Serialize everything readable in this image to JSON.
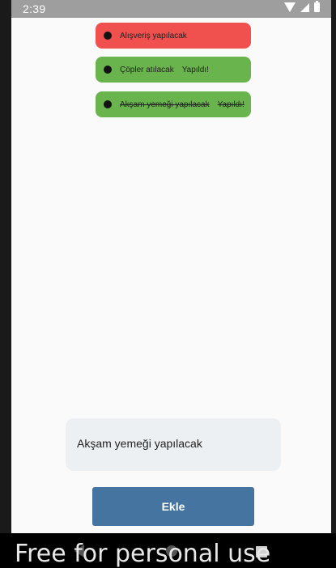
{
  "status_bar": {
    "time": "2:39"
  },
  "todos": [
    {
      "text": "Alışveriş yapılacak",
      "status": ""
    },
    {
      "text": "Çöpler atılacak",
      "status": "Yapıldı!"
    },
    {
      "text": "Akşam yemeği yapılacak",
      "status": "Yapıldı!"
    }
  ],
  "colors": {
    "pending": "#f0504e",
    "done": "#6ab44e",
    "button": "#44749f"
  },
  "form": {
    "input_value": "Akşam yemeği yapılacak",
    "submit_label": "Ekle"
  },
  "watermark": "Free for personal use"
}
